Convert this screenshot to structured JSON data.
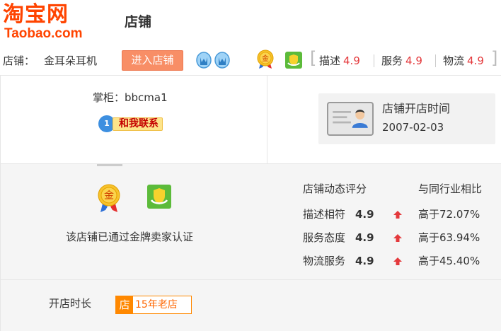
{
  "logo": {
    "cn": "淘宝网",
    "en": "Taobao.com"
  },
  "header": {
    "title": "店铺"
  },
  "shop": {
    "label": "店铺：",
    "name": "金耳朵耳机",
    "enter_button": "进入店铺",
    "ratings": [
      {
        "label": "描述",
        "value": "4.9"
      },
      {
        "label": "服务",
        "value": "4.9"
      },
      {
        "label": "物流",
        "value": "4.9"
      }
    ]
  },
  "keeper": {
    "label": "掌柜：bbcma1",
    "contact_button": "和我联系",
    "contact_icon": "1"
  },
  "opened": {
    "label": "店铺开店时间",
    "date": "2007-02-03"
  },
  "cert": {
    "text": "该店铺已通过金牌卖家认证",
    "gold_icon_char": "金"
  },
  "dsr": {
    "head": "店铺动态评分",
    "compare_head": "与同行业相比",
    "rows": [
      {
        "label": "描述相符",
        "value": "4.9",
        "compare": "高于72.07%"
      },
      {
        "label": "服务态度",
        "value": "4.9",
        "compare": "高于63.94%"
      },
      {
        "label": "物流服务",
        "value": "4.9",
        "compare": "高于45.40%"
      }
    ]
  },
  "shop_age": {
    "label": "开店时长",
    "badge_char": "店",
    "badge_text": "15年老店"
  },
  "colors": {
    "brand": "#ff4400",
    "accent_button": "#f88e66",
    "rating_red": "#e4393c",
    "badge_orange": "#ff8800",
    "panel_gray": "#f5f5f5"
  },
  "icons": [
    "crown-icon",
    "gold-seller-icon",
    "shield-icon",
    "id-card-icon",
    "up-arrow-icon",
    "chat-bubble-icon"
  ]
}
